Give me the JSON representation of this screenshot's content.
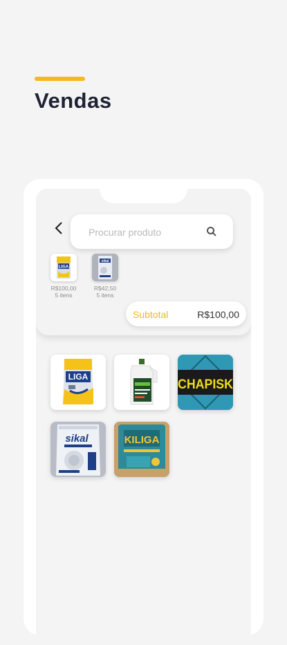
{
  "header": {
    "title": "Vendas"
  },
  "search": {
    "placeholder": "Procurar produto"
  },
  "cart": {
    "items": [
      {
        "brand": "LIGA",
        "price": "R$100,00",
        "qty": "5 itens"
      },
      {
        "brand": "sikal",
        "price": "R$42,50",
        "qty": "5 itens"
      }
    ]
  },
  "subtotal": {
    "label": "Subtotal",
    "value": "R$100,00"
  },
  "products": [
    {
      "name": "LIGA",
      "icon": "liga-bag-icon"
    },
    {
      "name": "bottle",
      "icon": "bottle-icon"
    },
    {
      "name": "CHAPISK",
      "icon": "chapisk-logo"
    },
    {
      "name": "sikal",
      "icon": "sikal-bag-icon"
    },
    {
      "name": "KILIGA",
      "icon": "kiliga-bag-icon"
    }
  ],
  "colors": {
    "accent": "#f5b81d",
    "title": "#1f2233",
    "background": "#f4f4f4"
  }
}
